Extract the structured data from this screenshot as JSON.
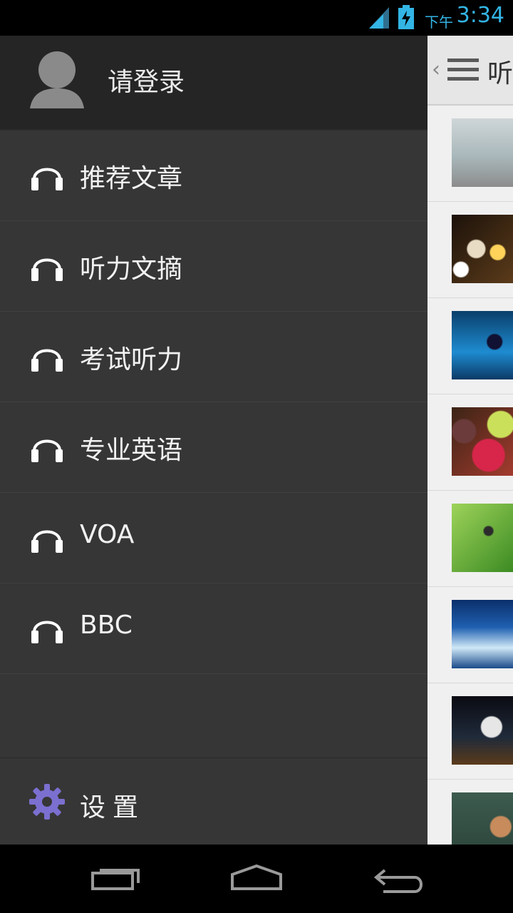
{
  "status_bar": {
    "ampm": "下午",
    "time": "3:34",
    "accent_color": "#33b5e5"
  },
  "drawer": {
    "header": {
      "login_label": "请登录",
      "avatar_icon": "user-avatar-icon"
    },
    "items": [
      {
        "label": "推荐文章",
        "icon": "headphones-icon"
      },
      {
        "label": "听力文摘",
        "icon": "headphones-icon"
      },
      {
        "label": "考试听力",
        "icon": "headphones-icon"
      },
      {
        "label": "专业英语",
        "icon": "headphones-icon"
      },
      {
        "label": "VOA",
        "icon": "headphones-icon"
      },
      {
        "label": "BBC",
        "icon": "headphones-icon"
      }
    ],
    "settings": {
      "label": "设置",
      "icon": "gear-icon",
      "icon_color": "#7b6fd0"
    }
  },
  "content": {
    "title_fragment": "听",
    "thumbnails": [
      {
        "icon": "thumbnail-image"
      },
      {
        "icon": "thumbnail-image"
      },
      {
        "icon": "thumbnail-image"
      },
      {
        "icon": "thumbnail-image"
      },
      {
        "icon": "thumbnail-image"
      },
      {
        "icon": "thumbnail-image"
      },
      {
        "icon": "thumbnail-image"
      },
      {
        "icon": "thumbnail-image"
      }
    ]
  },
  "nav_bar": {
    "buttons": [
      "recent-apps-icon",
      "home-icon",
      "back-icon"
    ]
  }
}
